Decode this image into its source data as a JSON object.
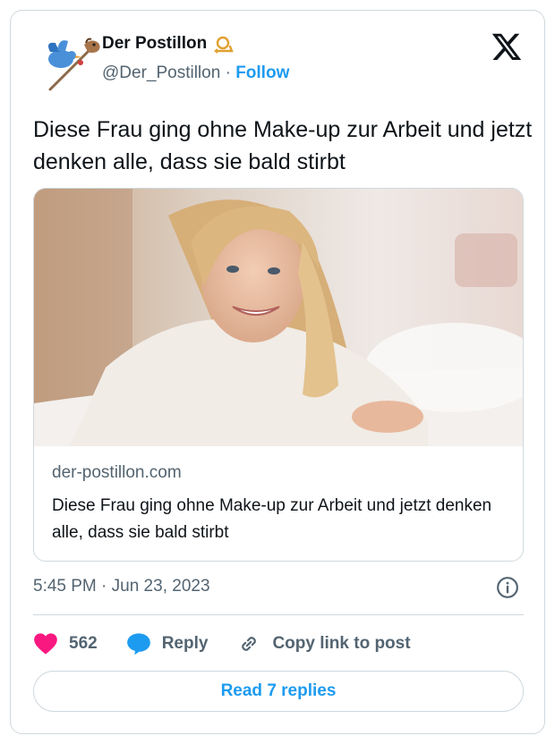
{
  "author": {
    "display_name": "Der Postillon",
    "handle": "@Der_Postillon",
    "separator": " · ",
    "follow_label": "Follow",
    "badge_icon": "posthorn-icon"
  },
  "tweet": {
    "text": "Diese Frau ging ohne Make-up zur Arbeit und jetzt denken alle, dass sie bald stirbt"
  },
  "link_card": {
    "domain": "der-postillon.com",
    "title": "Diese Frau ging ohne Make-up zur Arbeit und jetzt denken alle, dass sie bald stirbt",
    "image": "smiling-woman-photo"
  },
  "meta": {
    "timestamp": "5:45 PM · Jun 23, 2023",
    "info_icon": "info-icon"
  },
  "actions": {
    "likes": "562",
    "reply_label": "Reply",
    "copy_label": "Copy link to post"
  },
  "read_replies_label": "Read 7 replies",
  "colors": {
    "accent": "#1d9bf0",
    "like": "#f91880",
    "text_primary": "#0f1419",
    "text_secondary": "#536471",
    "border": "#cfd9de"
  }
}
